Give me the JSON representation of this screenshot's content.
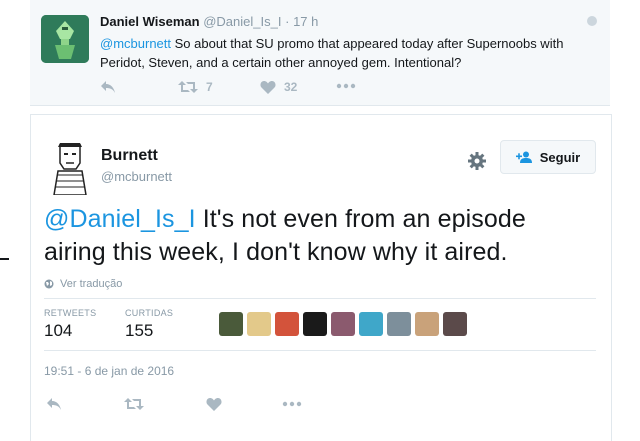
{
  "parent_tweet": {
    "author_name": "Daniel Wiseman",
    "handle": "@Daniel_Is_I",
    "separator": "·",
    "time": "17 h",
    "mention": "@mcburnett",
    "text": " So about that SU promo that appeared today after Supernoobs with Peridot, Steven, and a certain other annoyed gem. Intentional?",
    "retweet_count": "7",
    "like_count": "32"
  },
  "main_tweet": {
    "author_name": "Burnett",
    "handle": "@mcburnett",
    "follow_label": "Seguir",
    "mention": "@Daniel_Is_I",
    "text": " It's not even from an episode airing this week, I don't know why it aired.",
    "translate_label": "Ver tradução",
    "retweets_label": "RETWEETS",
    "retweets_value": "104",
    "likes_label": "CURTIDAS",
    "likes_value": "155",
    "timestamp": "19:51 - 6 de jan de 2016",
    "likers": [
      {
        "name": "liker-avatar-1",
        "color": "#4a5a3a"
      },
      {
        "name": "liker-avatar-2",
        "color": "#e3c98a"
      },
      {
        "name": "liker-avatar-3",
        "color": "#d3533b"
      },
      {
        "name": "liker-avatar-4",
        "color": "#1a1a1a"
      },
      {
        "name": "liker-avatar-5",
        "color": "#8b5a6e"
      },
      {
        "name": "liker-avatar-6",
        "color": "#3fa7c9"
      },
      {
        "name": "liker-avatar-7",
        "color": "#7d8f9b"
      },
      {
        "name": "liker-avatar-8",
        "color": "#c9a27a"
      },
      {
        "name": "liker-avatar-9",
        "color": "#5b4a4a"
      }
    ]
  },
  "colors": {
    "link_blue": "#1b95e0",
    "muted_gray": "#8899a6",
    "icon_gray": "#aab8c2",
    "parent_bg": "#f5f8fa"
  },
  "icons": [
    "reply-icon",
    "retweet-icon",
    "heart-icon",
    "more-icon",
    "gear-icon",
    "follow-user-icon",
    "globe-icon"
  ]
}
